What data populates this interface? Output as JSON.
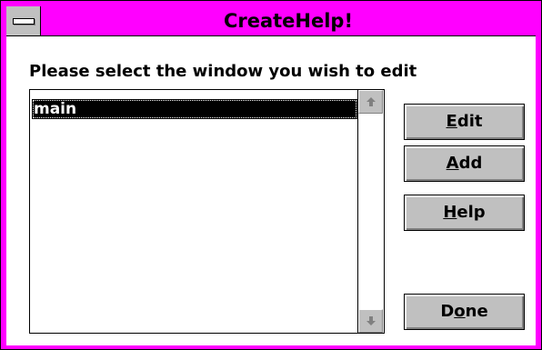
{
  "window": {
    "title": "CreateHelp!"
  },
  "prompt": "Please select the window you wish to edit",
  "listbox": {
    "items": [
      "main"
    ],
    "selected_index": 0
  },
  "buttons": {
    "edit": {
      "mnemonic": "E",
      "rest": "dit"
    },
    "add": {
      "mnemonic": "A",
      "rest": "dd"
    },
    "help": {
      "mnemonic": "H",
      "rest": "elp"
    },
    "done": {
      "pre": "D",
      "mnemonic": "o",
      "rest": "ne"
    }
  },
  "colors": {
    "titlebar": "#ff00ff",
    "selection": "#000000",
    "button_face": "#c0c0c0"
  },
  "icons": {
    "system_menu": "system-menu-icon",
    "scroll_up": "scroll-up-arrow-icon",
    "scroll_down": "scroll-down-arrow-icon"
  }
}
